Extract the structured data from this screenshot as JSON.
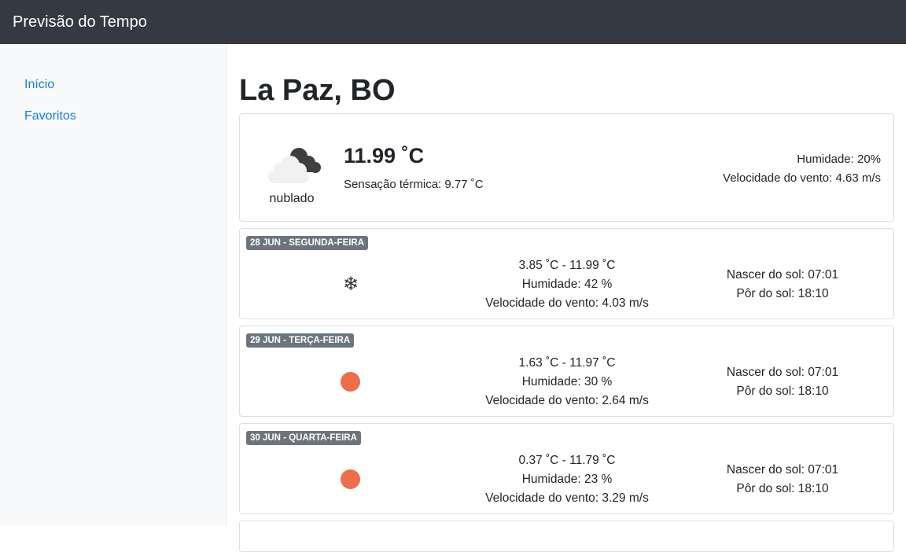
{
  "app": {
    "title": "Previsão do Tempo"
  },
  "sidebar": {
    "items": [
      {
        "label": "Início"
      },
      {
        "label": "Favoritos"
      }
    ]
  },
  "location": {
    "name": "La Paz, BO"
  },
  "current": {
    "icon": "cloudy-icon",
    "description": "nublado",
    "temperature": "11.99 ˚C",
    "feels_like": "Sensação térmica: 9.77 ˚C",
    "humidity": "Humidade: 20%",
    "wind": "Velocidade do vento: 4.63 m/s"
  },
  "forecast": [
    {
      "date": "28 JUN - SEGUNDA-FEIRA",
      "icon": "snowflake-icon",
      "temp_range": "3.85 ˚C - 11.99 ˚C",
      "humidity": "Humidade: 42 %",
      "wind": "Velocidade do vento: 4.03 m/s",
      "sunrise": "Nascer do sol: 07:01",
      "sunset": "Pôr do sol: 18:10"
    },
    {
      "date": "29 JUN - TERÇA-FEIRA",
      "icon": "sun-icon",
      "temp_range": "1.63 ˚C - 11.97 ˚C",
      "humidity": "Humidade: 30 %",
      "wind": "Velocidade do vento: 2.64 m/s",
      "sunrise": "Nascer do sol: 07:01",
      "sunset": "Pôr do sol: 18:10"
    },
    {
      "date": "30 JUN - QUARTA-FEIRA",
      "icon": "sun-icon",
      "temp_range": "0.37 ˚C - 11.79 ˚C",
      "humidity": "Humidade: 23 %",
      "wind": "Velocidade do vento: 3.29 m/s",
      "sunrise": "Nascer do sol: 07:01",
      "sunset": "Pôr do sol: 18:10"
    }
  ],
  "colors": {
    "navbar": "#343a40",
    "link": "#1a7ae0",
    "badge": "#6c757d",
    "sun": "#ec6e4c"
  }
}
